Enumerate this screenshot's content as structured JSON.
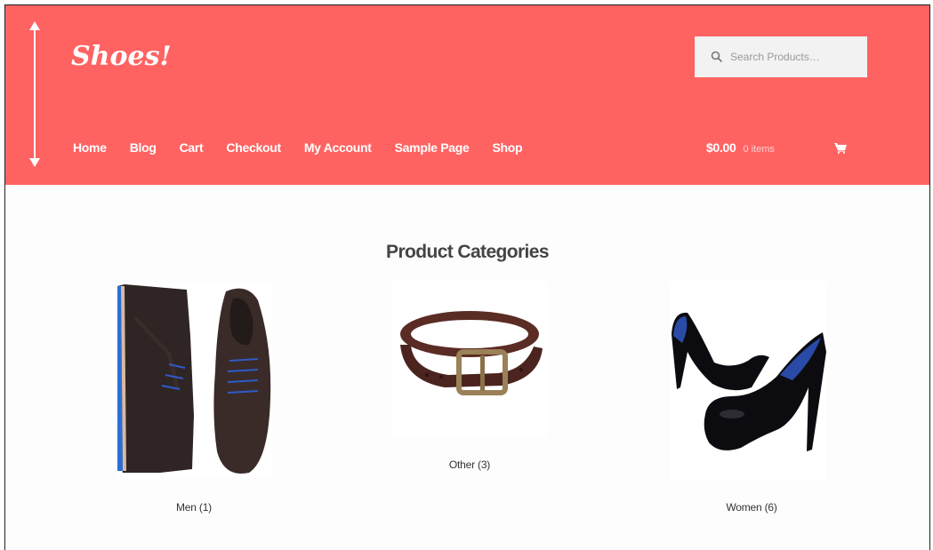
{
  "header": {
    "logo_text": "Shoes!",
    "search": {
      "placeholder": "Search Products…"
    },
    "nav": [
      "Home",
      "Blog",
      "Cart",
      "Checkout",
      "My Account",
      "Sample Page",
      "Shop"
    ],
    "cart": {
      "amount": "$0.00",
      "items": "0 items"
    },
    "colors": {
      "brand": "#fe6362",
      "text": "#ffffff"
    }
  },
  "main": {
    "title": "Product Categories",
    "categories": [
      {
        "name": "Men",
        "count": "(1)"
      },
      {
        "name": "Other",
        "count": "(3)"
      },
      {
        "name": "Women",
        "count": "(6)"
      }
    ]
  }
}
